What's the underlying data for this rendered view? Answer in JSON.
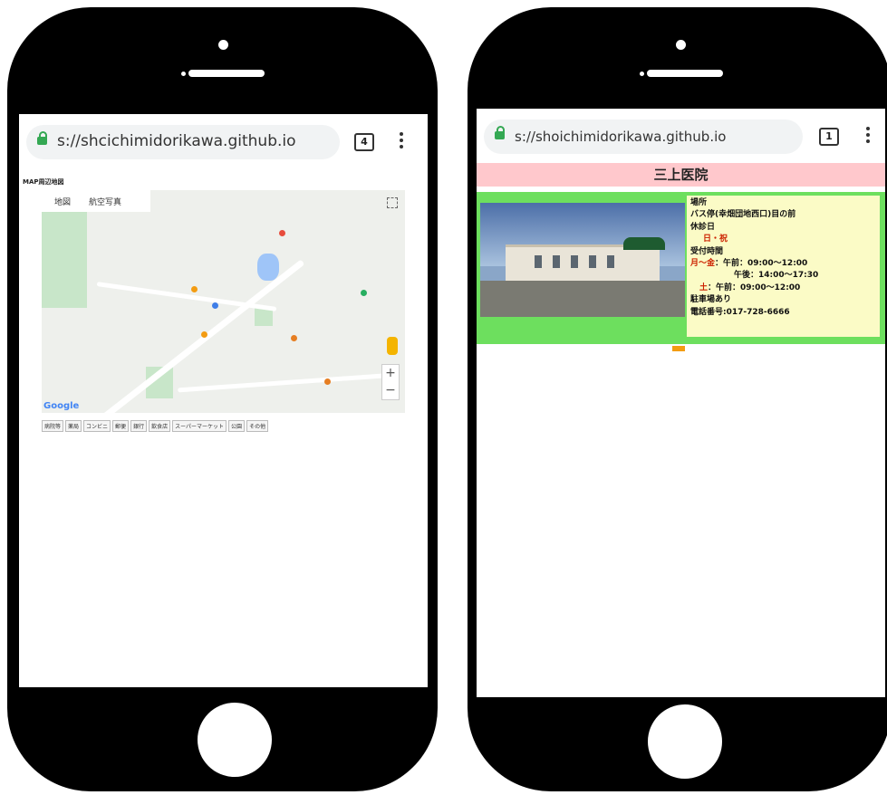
{
  "left_phone": {
    "url": "s://shcichimidorikawa.github.io",
    "tab_count": "4",
    "page_title": "MAP周辺地図",
    "map": {
      "tabs": [
        "地図",
        "航空写真"
      ],
      "attribution": "Google",
      "zoom_in": "+",
      "zoom_out": "−"
    },
    "categories": [
      "病院等",
      "薬局",
      "コンビニ",
      "郵便",
      "銀行",
      "飲食店",
      "スーパーマーケット",
      "公園",
      "その他"
    ]
  },
  "right_phone": {
    "url": "s://shoichimidorikawa.github.io",
    "tab_count": "1",
    "clinic_name": "三上医院",
    "info": {
      "location_label": "場所",
      "location_value": "バス停(幸畑団地西口)目の前",
      "holiday_label": "休診日",
      "holiday_value": "日・祝",
      "hours_label": "受付時間",
      "weekday_days": "月～金",
      "weekday_am": "：午前：09:00～12:00",
      "weekday_pm": "午後：14:00～17:30",
      "saturday_day": "土",
      "saturday_hours": "：午前：09:00～12:00",
      "parking": "駐車場あり",
      "phone": "電話番号:017-728-6666"
    }
  }
}
